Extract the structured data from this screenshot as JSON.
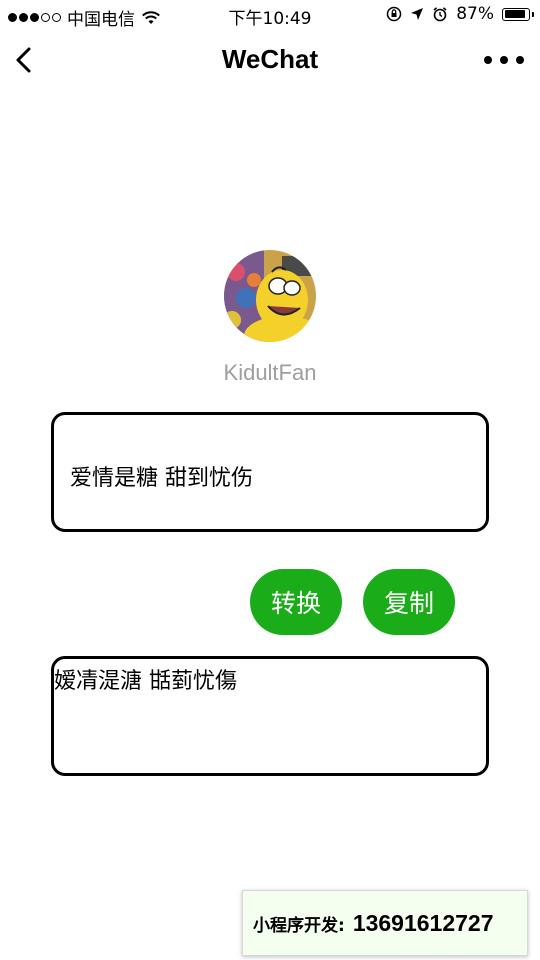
{
  "status_bar": {
    "carrier": "中国电信",
    "time": "下午10:49",
    "battery_percent": "87%",
    "battery_level": 0.87,
    "signal_bars_filled": 3,
    "signal_bars_total": 5
  },
  "nav": {
    "title": "WeChat",
    "back_icon": "chevron-left-icon",
    "more_icon": "more-dots-icon"
  },
  "profile": {
    "username": "KidultFan"
  },
  "converter": {
    "input_text": "爱情是糖 甜到忧伤",
    "output_text": "嫒凊湜溏 甛菿忧傷",
    "convert_label": "转换",
    "copy_label": "复制"
  },
  "footer": {
    "dev_label": "小程序开发:",
    "dev_phone": "13691612727"
  },
  "colors": {
    "accent": "#1aad19",
    "username": "#9e9e9e",
    "banner_bg": "#f5fff0"
  }
}
